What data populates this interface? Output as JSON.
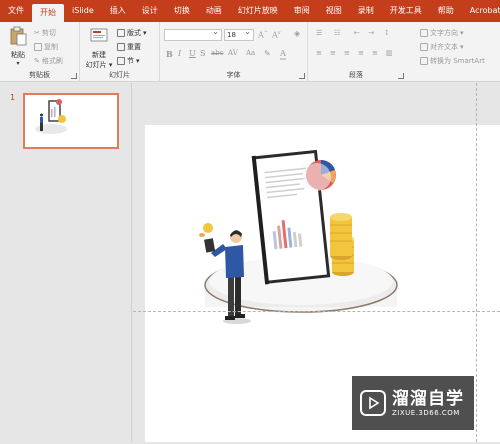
{
  "tabs": [
    "文件",
    "开始",
    "iSlide",
    "插入",
    "设计",
    "切换",
    "动画",
    "幻灯片放映",
    "审阅",
    "视图",
    "录制",
    "开发工具",
    "帮助",
    "Acrobat"
  ],
  "active_tab_index": 1,
  "clipboard": {
    "paste_label": "粘贴",
    "cut_label": "剪切",
    "copy_label": "复制",
    "format_painter_label": "格式刷",
    "group_label": "剪贴板"
  },
  "slides_group": {
    "new_slide_label": "新建",
    "new_slide_label2": "幻灯片",
    "layout_label": "版式",
    "reset_label": "重置",
    "section_label": "节",
    "group_label": "幻灯片"
  },
  "font_group": {
    "font_name_value": "",
    "font_size_value": "18",
    "group_label": "字体"
  },
  "paragraph_group": {
    "text_direction_label": "文字方向",
    "align_text_label": "对齐文本",
    "smartart_label": "转换为 SmartArt",
    "group_label": "段落"
  },
  "thumbnail_panel": {
    "slide_number": "1"
  },
  "watermark": {
    "title": "溜溜自学",
    "url": "ZIXUE.3D66.COM"
  },
  "colors": {
    "accent": "#c43e1c",
    "thumb_border": "#e07b5c",
    "figure_shirt": "#2e58a6",
    "coin": "#f2c53d"
  }
}
